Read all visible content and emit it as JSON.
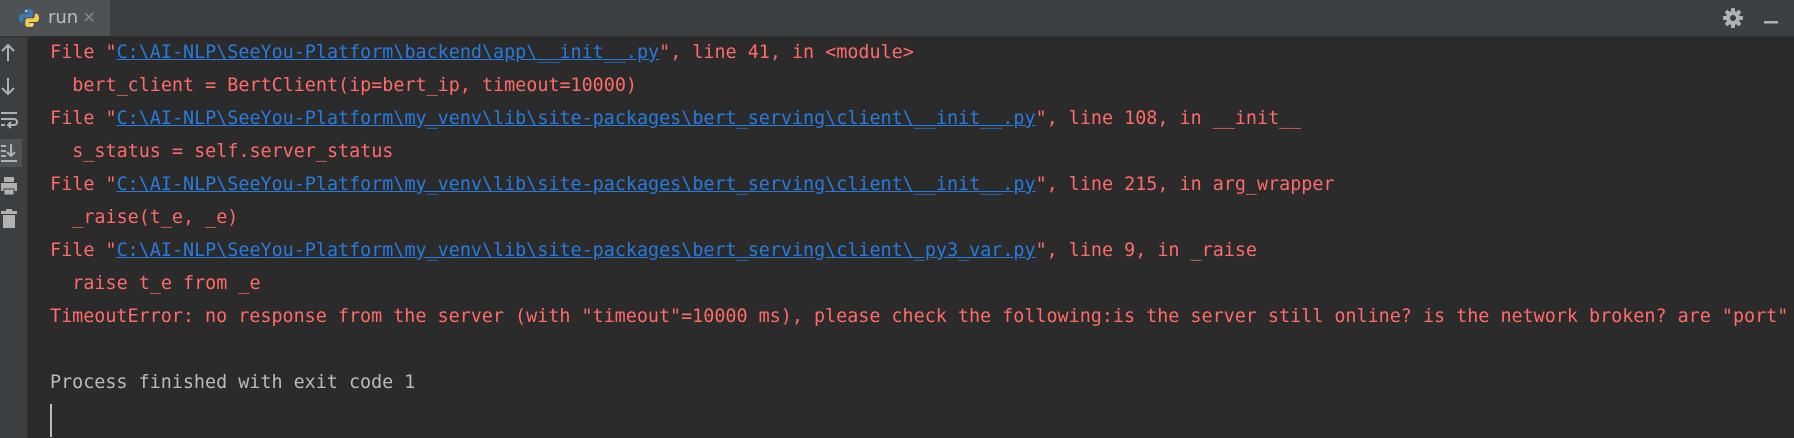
{
  "tab": {
    "label": "run",
    "icon": "python-icon"
  },
  "toolbar": {
    "buttons": [
      "arrow-up-icon",
      "arrow-down-icon",
      "soft-wrap-icon",
      "scroll-to-end-icon",
      "print-icon",
      "trash-icon"
    ]
  },
  "console": {
    "lines": [
      {
        "prefix": "  File \"",
        "path": "C:\\AI-NLP\\SeeYou-Platform\\backend\\app\\__init__.py",
        "suffix": "\", line 41, in <module>"
      },
      {
        "text": "    bert_client = BertClient(ip=bert_ip, timeout=10000)"
      },
      {
        "prefix": "  File \"",
        "path": "C:\\AI-NLP\\SeeYou-Platform\\my_venv\\lib\\site-packages\\bert_serving\\client\\__init__.py",
        "suffix": "\", line 108, in __init__"
      },
      {
        "text": "    s_status = self.server_status"
      },
      {
        "prefix": "  File \"",
        "path": "C:\\AI-NLP\\SeeYou-Platform\\my_venv\\lib\\site-packages\\bert_serving\\client\\__init__.py",
        "suffix": "\", line 215, in arg_wrapper"
      },
      {
        "text": "    _raise(t_e, _e)"
      },
      {
        "prefix": "  File \"",
        "path": "C:\\AI-NLP\\SeeYou-Platform\\my_venv\\lib\\site-packages\\bert_serving\\client\\_py3_var.py",
        "suffix": "\", line 9, in _raise"
      },
      {
        "text": "    raise t_e from _e"
      },
      {
        "text": "TimeoutError: no response from the server (with \"timeout\"=10000 ms), please check the following:is the server still online? is the network broken? are \"port\" a"
      },
      {
        "text": ""
      },
      {
        "text": "Process finished with exit code 1"
      }
    ]
  },
  "colors": {
    "background": "#2b2b2b",
    "panel": "#3c3f41",
    "error_text": "#ff6b68",
    "link": "#287bde",
    "output_text": "#bbbbbb"
  }
}
